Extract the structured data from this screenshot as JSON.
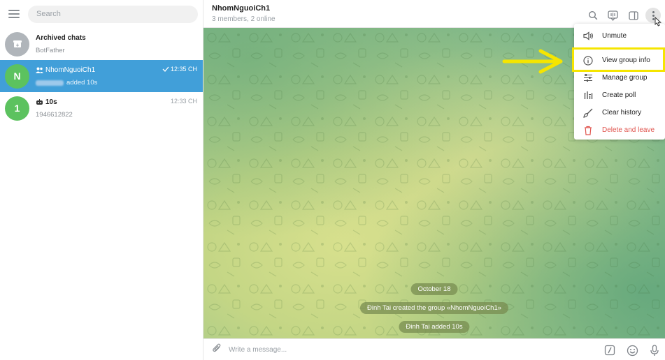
{
  "sidebar": {
    "search_placeholder": "Search",
    "chats": [
      {
        "avatar": "",
        "title": "Archived chats",
        "subtitle": "BotFather",
        "time": ""
      },
      {
        "avatar": "N",
        "title": "NhomNguoiCh1",
        "subtitle": "added 10s",
        "time": "12:35 CH"
      },
      {
        "avatar": "1",
        "title": "10s",
        "subtitle": "1946612822",
        "time": "12:33 CH"
      }
    ]
  },
  "header": {
    "title": "NhomNguoiCh1",
    "subtitle": "3 members, 2 online"
  },
  "messages": {
    "date": "October 18",
    "service1": "Đinh Tai created the group «NhomNguoiCh1»",
    "service2": "Đinh Tai added 10s"
  },
  "composer": {
    "placeholder": "Write a message..."
  },
  "menu": {
    "items": [
      {
        "label": "Unmute",
        "icon": "speaker-icon"
      },
      {
        "label": "View group info",
        "icon": "info-icon"
      },
      {
        "label": "Manage group",
        "icon": "sliders-icon"
      },
      {
        "label": "Create poll",
        "icon": "poll-icon"
      },
      {
        "label": "Clear history",
        "icon": "broom-icon"
      },
      {
        "label": "Delete and leave",
        "icon": "trash-icon"
      }
    ]
  },
  "colors": {
    "accent": "#419fd9",
    "avatar_green": "#5cc25f",
    "highlight": "#f5e500",
    "danger": "#e0554f"
  }
}
